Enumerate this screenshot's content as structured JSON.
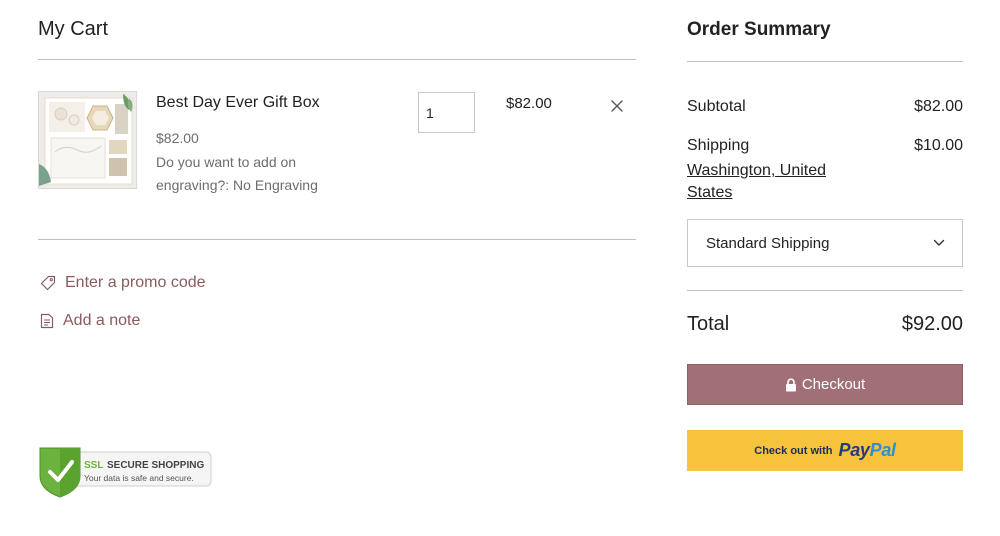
{
  "cart": {
    "title": "My Cart",
    "item": {
      "name": "Best Day Ever Gift Box",
      "unit_price": "$82.00",
      "option": "Do you want to add on engraving?: No Engraving",
      "quantity": "1",
      "line_total": "$82.00",
      "image_icon": "gift-box-product-image"
    },
    "promo_label": "Enter a promo code",
    "note_label": "Add a note",
    "ssl": {
      "line1": "SSL",
      "line2": "SECURE SHOPPING",
      "line3": "Your data is safe and secure."
    }
  },
  "summary": {
    "title": "Order Summary",
    "subtotal_label": "Subtotal",
    "subtotal_value": "$82.00",
    "shipping_label": "Shipping",
    "shipping_value": "$10.00",
    "shipping_location": "Washington, United States",
    "shipping_method": "Standard Shipping",
    "total_label": "Total",
    "total_value": "$92.00",
    "checkout_label": "Checkout",
    "paypal_prefix": "Check out with",
    "paypal_word_a": "Pay",
    "paypal_word_b": "Pal"
  },
  "colors": {
    "accent": "#a07076",
    "link": "#8a5a5e",
    "paypal_yellow": "#f7c33d"
  }
}
